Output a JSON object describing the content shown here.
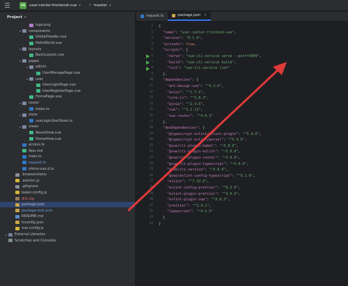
{
  "titlebar": {
    "project_badge": "UV",
    "project_name": "user-center-frontend-vue",
    "branch": "master"
  },
  "sidebar": {
    "title": "Project",
    "items": [
      {
        "label": "logo.png",
        "depth": 3,
        "icon": "img",
        "arrow": ""
      },
      {
        "label": "components",
        "depth": 2,
        "icon": "folder",
        "arrow": "v"
      },
      {
        "label": "GlobalHeader.vue",
        "depth": 3,
        "icon": "vue",
        "arrow": ""
      },
      {
        "label": "HelloWorld.vue",
        "depth": 3,
        "icon": "vue",
        "arrow": ""
      },
      {
        "label": "layouts",
        "depth": 2,
        "icon": "folder",
        "arrow": "v"
      },
      {
        "label": "BasicLayout.vue",
        "depth": 3,
        "icon": "vue",
        "arrow": ""
      },
      {
        "label": "pages",
        "depth": 2,
        "icon": "folder",
        "arrow": "v"
      },
      {
        "label": "admin",
        "depth": 3,
        "icon": "folder",
        "arrow": "v"
      },
      {
        "label": "UserManagePage.vue",
        "depth": 4,
        "icon": "vue",
        "arrow": ""
      },
      {
        "label": "user",
        "depth": 3,
        "icon": "folder",
        "arrow": "v"
      },
      {
        "label": "UserLoginPage.vue",
        "depth": 4,
        "icon": "vue",
        "arrow": ""
      },
      {
        "label": "UserRegisterPage.vue",
        "depth": 4,
        "icon": "vue",
        "arrow": ""
      },
      {
        "label": "HomePage.vue",
        "depth": 3,
        "icon": "vue",
        "arrow": ""
      },
      {
        "label": "router",
        "depth": 2,
        "icon": "folder",
        "arrow": "v"
      },
      {
        "label": "index.ts",
        "depth": 3,
        "icon": "ts",
        "arrow": ""
      },
      {
        "label": "store",
        "depth": 2,
        "icon": "folder",
        "arrow": "v"
      },
      {
        "label": "useLoginUserStore.ts",
        "depth": 3,
        "icon": "ts",
        "arrow": ""
      },
      {
        "label": "views",
        "depth": 2,
        "icon": "folder",
        "arrow": "v"
      },
      {
        "label": "AboutView.vue",
        "depth": 3,
        "icon": "vue",
        "arrow": ""
      },
      {
        "label": "HomeView.vue",
        "depth": 3,
        "icon": "vue",
        "arrow": ""
      },
      {
        "label": "access.ts",
        "depth": 2,
        "icon": "ts",
        "arrow": ""
      },
      {
        "label": "App.vue",
        "depth": 2,
        "icon": "vue",
        "arrow": ""
      },
      {
        "label": "main.ts",
        "depth": 2,
        "icon": "ts",
        "arrow": ""
      },
      {
        "label": "request.ts",
        "depth": 2,
        "icon": "ts",
        "arrow": "",
        "color": "blue"
      },
      {
        "label": "shims-vue.d.ts",
        "depth": 2,
        "icon": "ts",
        "arrow": ""
      },
      {
        "label": ".browserslistrc",
        "depth": 1,
        "icon": "cfg",
        "arrow": ""
      },
      {
        "label": ".eslintrc.js",
        "depth": 1,
        "icon": "js",
        "arrow": ""
      },
      {
        "label": ".gitignore",
        "depth": 1,
        "icon": "cfg",
        "arrow": ""
      },
      {
        "label": "babel.config.js",
        "depth": 1,
        "icon": "js",
        "arrow": ""
      },
      {
        "label": "dist.zip",
        "depth": 1,
        "icon": "zip",
        "arrow": "",
        "color": "red"
      },
      {
        "label": "package.json",
        "depth": 1,
        "icon": "json",
        "arrow": "",
        "selected": true
      },
      {
        "label": "package-lock.json",
        "depth": 1,
        "icon": "json",
        "arrow": "",
        "color": "blue"
      },
      {
        "label": "README.md",
        "depth": 1,
        "icon": "md",
        "arrow": ""
      },
      {
        "label": "tsconfig.json",
        "depth": 1,
        "icon": "json",
        "arrow": ""
      },
      {
        "label": "vue.config.js",
        "depth": 1,
        "icon": "js",
        "arrow": ""
      },
      {
        "label": "External Libraries",
        "depth": 0,
        "icon": "lib",
        "arrow": ">"
      },
      {
        "label": "Scratches and Consoles",
        "depth": 0,
        "icon": "scr",
        "arrow": ""
      }
    ]
  },
  "tabs": [
    {
      "label": "request.ts",
      "icon": "ts",
      "active": false
    },
    {
      "label": "package.json",
      "icon": "json",
      "active": true
    }
  ],
  "code_lines": [
    "{",
    "  \"name\": \"user-center-frontend-vue\",",
    "  \"version\": \"0.1.0\",",
    "  \"private\": true,",
    "  \"scripts\": {",
    "    \"serve\": \"vue-cli-service serve --port=3000\",",
    "    \"build\": \"vue-cli-service build\",",
    "    \"lint\": \"vue-cli-service lint\"",
    "  },",
    "  \"dependencies\": {",
    "    \"ant-design-vue\": \"^4.2.6\",",
    "    \"axios\": \"^1.7.9\",",
    "    \"core-js\": \"^3.8.3\",",
    "    \"pinia\": \"^2.3.0\",",
    "    \"vue\": \"^3.2.13\",",
    "    \"vue-router\": \"^4.0.3\"",
    "  },",
    "  \"devDependencies\": {",
    "    \"@typescript-eslint/eslint-plugin\": \"^5.4.0\",",
    "    \"@typescript-eslint/parser\": \"^5.4.0\",",
    "    \"@vue/cli-plugin-babel\": \"~5.0.0\",",
    "    \"@vue/cli-plugin-eslint\": \"~5.0.0\",",
    "    \"@vue/cli-plugin-router\": \"~5.0.0\",",
    "    \"@vue/cli-plugin-typescript\": \"~5.0.0\",",
    "    \"@vue/cli-service\": \"~5.0.0\",",
    "    \"@vue/eslint-config-typescript\": \"^9.1.0\",",
    "    \"eslint\": \"^7.32.0\",",
    "    \"eslint-config-prettier\": \"^8.3.0\",",
    "    \"eslint-plugin-prettier\": \"^4.0.0\",",
    "    \"eslint-plugin-vue\": \"^8.0.3\",",
    "    \"prettier\": \"^2.4.1\",",
    "    \"typescript\": \"~4.5.5\"",
    "  }",
    "}"
  ],
  "colors": {
    "accent": "#3574f0",
    "arrow": "#e03a3a",
    "run": "#4caf50"
  }
}
